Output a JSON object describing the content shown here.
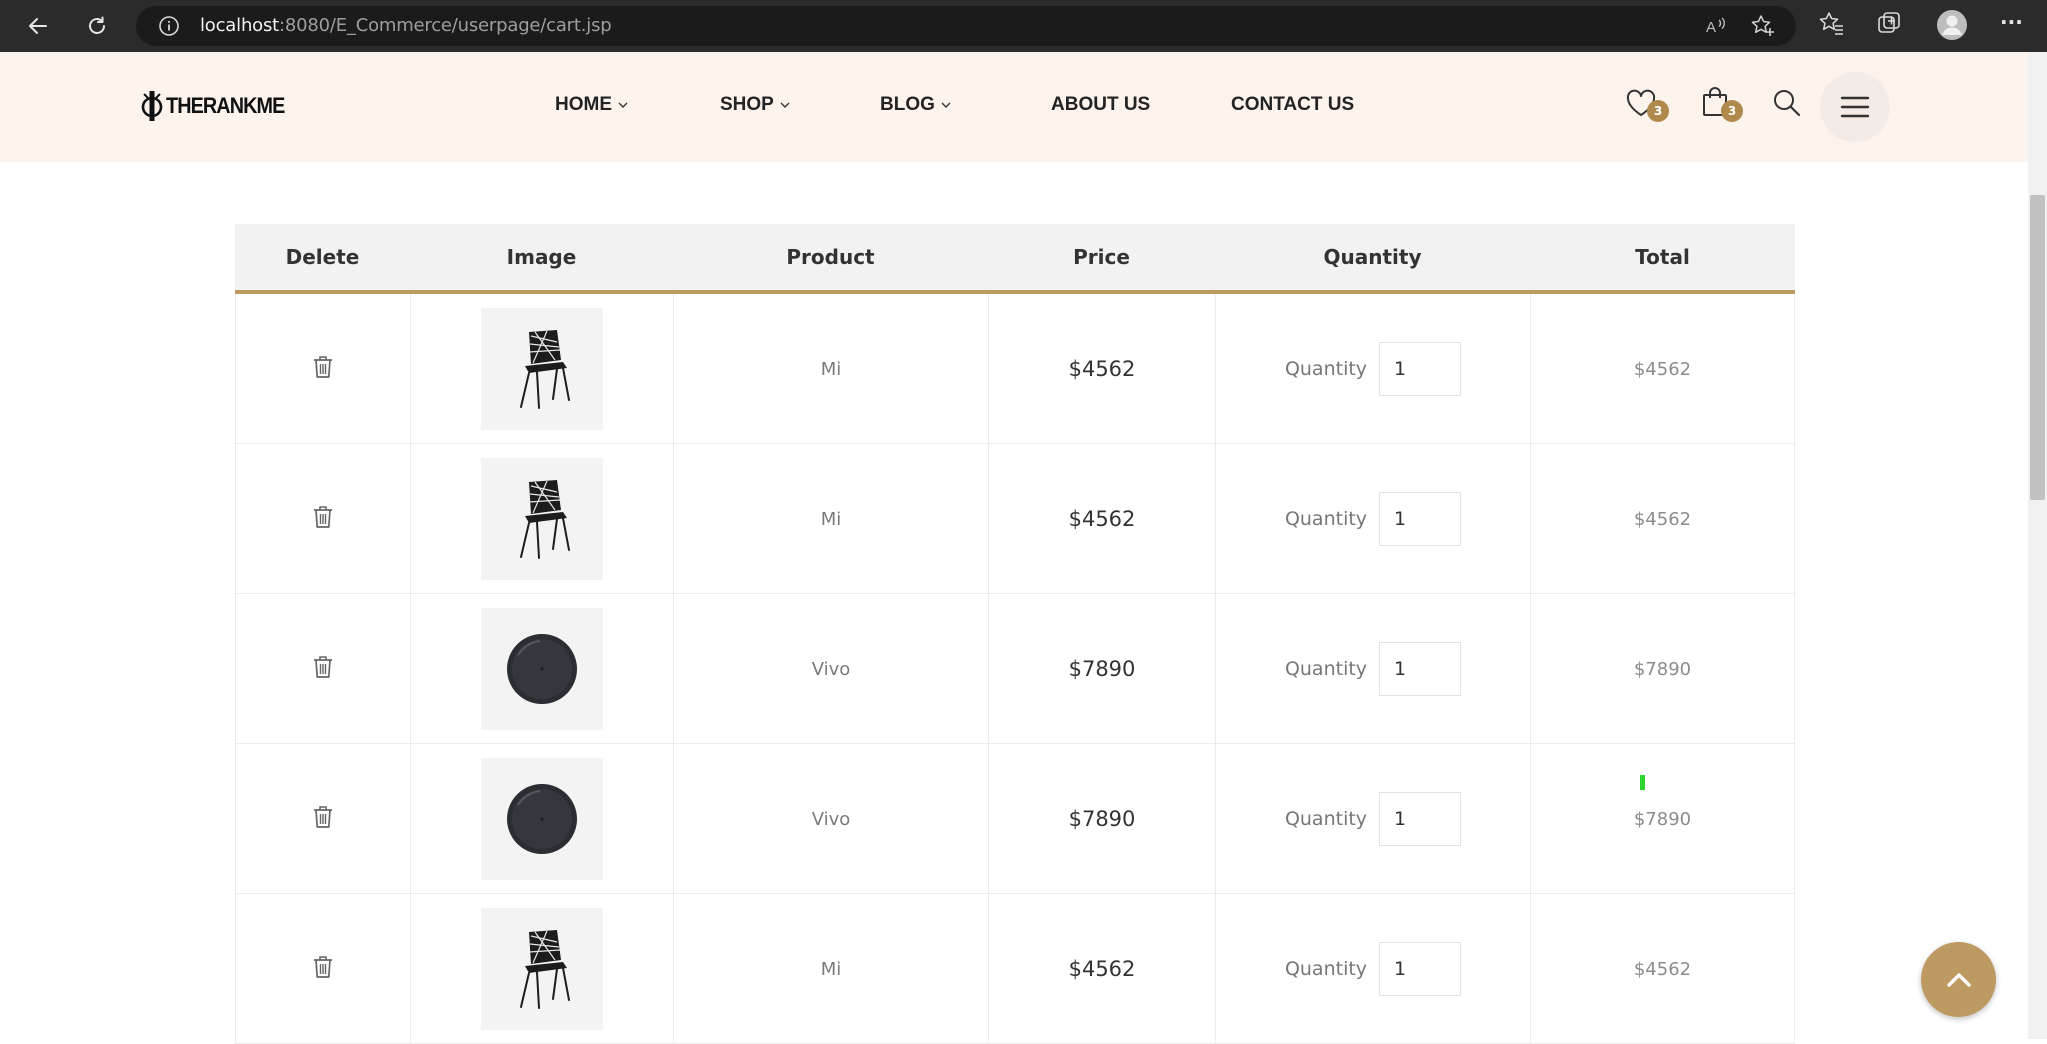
{
  "browser": {
    "url_host": "localhost",
    "url_rest": ":8080/E_Commerce/userpage/cart.jsp",
    "more_label": "···"
  },
  "header": {
    "logo_text": "THERANKME",
    "nav": [
      {
        "label": "HOME",
        "has_dropdown": true
      },
      {
        "label": "SHOP",
        "has_dropdown": true
      },
      {
        "label": "BLOG",
        "has_dropdown": true
      },
      {
        "label": "ABOUT US",
        "has_dropdown": false
      },
      {
        "label": "CONTACT US",
        "has_dropdown": false
      }
    ],
    "wishlist_count": "3",
    "cart_count": "3"
  },
  "table": {
    "columns": [
      "Delete",
      "Image",
      "Product",
      "Price",
      "Quantity",
      "Total"
    ],
    "quantity_label": "Quantity",
    "rows": [
      {
        "image": "chair",
        "product": "Mi",
        "price": "$4562",
        "quantity": "1",
        "total": "$4562"
      },
      {
        "image": "chair",
        "product": "Mi",
        "price": "$4562",
        "quantity": "1",
        "total": "$4562"
      },
      {
        "image": "dish",
        "product": "Vivo",
        "price": "$7890",
        "quantity": "1",
        "total": "$7890"
      },
      {
        "image": "dish",
        "product": "Vivo",
        "price": "$7890",
        "quantity": "1",
        "total": "$7890"
      },
      {
        "image": "chair",
        "product": "Mi",
        "price": "$4562",
        "quantity": "1",
        "total": "$4562"
      }
    ]
  },
  "colors": {
    "accent": "#bd9a62",
    "header_bg": "#fcf3ec",
    "badge": "#b0894c"
  },
  "icons": {
    "delete": "trash-icon",
    "back_to_top": "chevron-up-icon"
  }
}
